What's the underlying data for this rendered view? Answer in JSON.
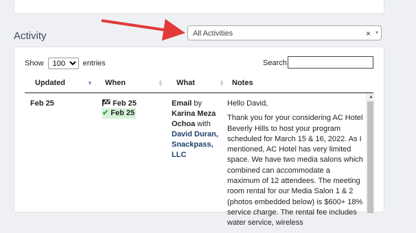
{
  "section": {
    "title": "Activity"
  },
  "filter": {
    "value": "All Activities",
    "clear_glyph": "×",
    "caret_glyph": "▾"
  },
  "table_controls": {
    "show_label": "Show",
    "entries_value": "100",
    "entries_label": "entries",
    "search_label": "Search:",
    "search_value": ""
  },
  "columns": [
    "Updated",
    "When",
    "What",
    "Notes"
  ],
  "rows": [
    {
      "updated": "Feb 25",
      "when_start": "Feb 25",
      "when_done": "Feb 25",
      "what": {
        "type": "Email",
        "by_label": "by",
        "author": "Karina Meza Ochoa",
        "with_label": "with",
        "contact": "David Duran, Snackpass, LLC"
      },
      "notes_greeting": "Hello David,",
      "notes_body": "Thank you for your considering AC Hotel Beverly Hills to host your program scheduled for March 15 & 16, 2022. As I mentioned, AC Hotel has very limited space. We have two media salons which combined can accommodate a maximum of 12 attendees. The meeting room rental for our Media Salon 1 & 2 (photos embedded below) is $600+ 18% service charge. The rental fee includes water service, wireless"
    }
  ],
  "colors": {
    "arrow": "#e03a3a",
    "done_bg": "#d4f1d6",
    "check": "#2ea043",
    "contact": "#1c3f6b"
  }
}
